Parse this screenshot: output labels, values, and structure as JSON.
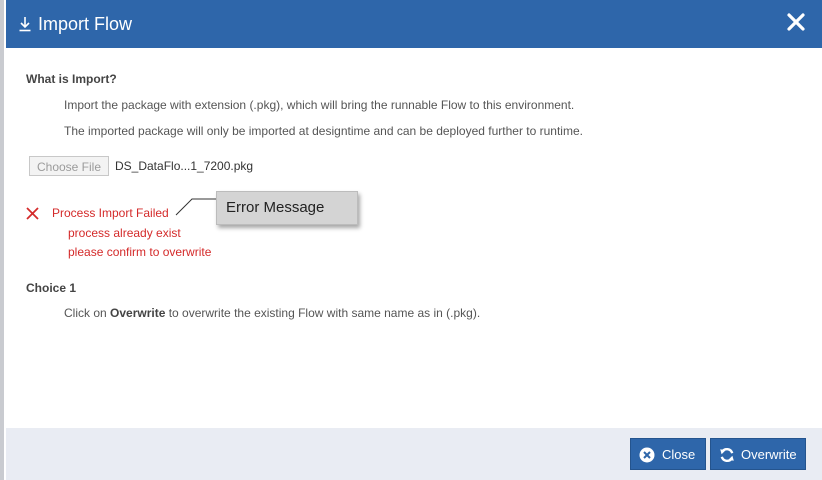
{
  "dialog": {
    "title": "Import Flow",
    "header_icon": "download-icon",
    "close_icon": "close-icon"
  },
  "what_is_import": {
    "heading": "What is Import?",
    "line1": "Import the package with extension (.pkg), which will bring the runnable Flow to this environment.",
    "line2": "The imported package will only be imported at designtime and can be deployed further to runtime."
  },
  "file_input": {
    "button_label": "Choose File",
    "file_name": "DS_DataFlo...1_7200.pkg"
  },
  "error": {
    "icon": "error-x-icon",
    "line1": "Process Import Failed",
    "line2": "process already exist",
    "line3": "please confirm to overwrite",
    "color": "#d42a2a"
  },
  "annotation": {
    "label": "Error Message"
  },
  "choice1": {
    "heading": "Choice 1",
    "text_before": "Click on ",
    "text_bold": "Overwrite",
    "text_after": " to overwrite the existing Flow with same name as in (.pkg)."
  },
  "footer": {
    "close_label": "Close",
    "close_icon": "close-circle-icon",
    "overwrite_label": "Overwrite",
    "overwrite_icon": "refresh-icon"
  },
  "colors": {
    "header_bg": "#2e66aa",
    "button_bg": "#2e66aa",
    "footer_bg": "#e9ecf3"
  }
}
